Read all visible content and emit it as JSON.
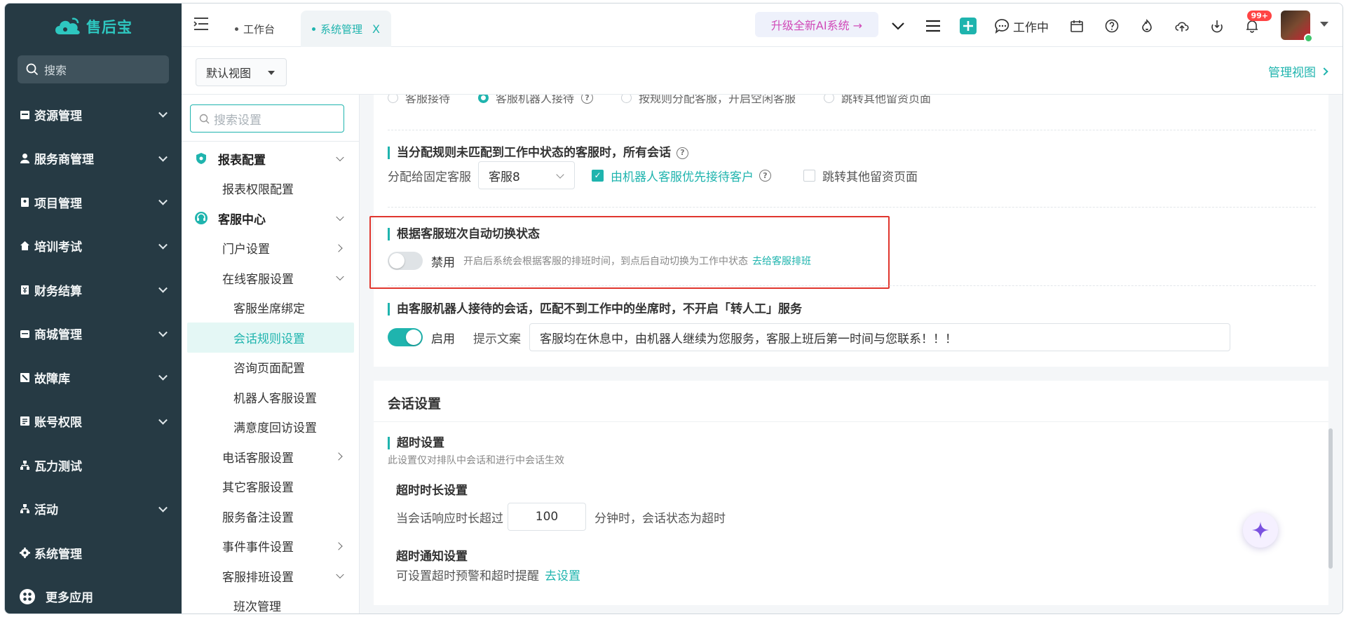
{
  "app": {
    "logo_text": "售后宝"
  },
  "sidebar": {
    "search_placeholder": "搜索",
    "items": [
      {
        "label": "资源管理",
        "icon": "resource-icon"
      },
      {
        "label": "服务商管理",
        "icon": "user-icon"
      },
      {
        "label": "项目管理",
        "icon": "project-icon"
      },
      {
        "label": "培训考试",
        "icon": "home-icon"
      },
      {
        "label": "财务结算",
        "icon": "finance-icon"
      },
      {
        "label": "商城管理",
        "icon": "store-icon"
      },
      {
        "label": "故障库",
        "icon": "fault-icon"
      },
      {
        "label": "账号权限",
        "icon": "account-icon"
      },
      {
        "label": "瓦力测试",
        "icon": "test-icon"
      },
      {
        "label": "活动",
        "icon": "activity-icon"
      },
      {
        "label": "系统管理",
        "icon": "gear-icon"
      }
    ],
    "more_label": "更多应用"
  },
  "header": {
    "tabs": [
      {
        "label": "工作台"
      },
      {
        "label": "系统管理",
        "close": "X"
      }
    ],
    "ai_upgrade": "升级全新AI系统 →",
    "status_label": "工作中",
    "notification_badge": "99+"
  },
  "viewbar": {
    "view_select": "默认视图",
    "manage_view": "管理视图"
  },
  "settings_nav": {
    "search_placeholder": "搜索设置",
    "items": [
      {
        "label": "报表配置"
      },
      {
        "label": "报表权限配置"
      },
      {
        "label": "客服中心"
      },
      {
        "label": "门户设置"
      },
      {
        "label": "在线客服设置"
      },
      {
        "label": "客服坐席绑定"
      },
      {
        "label": "会话规则设置"
      },
      {
        "label": "咨询页面配置"
      },
      {
        "label": "机器人客服设置"
      },
      {
        "label": "满意度回访设置"
      },
      {
        "label": "电话客服设置"
      },
      {
        "label": "其它客服设置"
      },
      {
        "label": "服务备注设置"
      },
      {
        "label": "事件事件设置"
      },
      {
        "label": "客服排班设置"
      },
      {
        "label": "班次管理"
      }
    ]
  },
  "main": {
    "cut_options": [
      "客服接待",
      "客服机器人接待",
      "按规则分配客服，开启空闲客服",
      "跳转其他留资页面"
    ],
    "unmatched": {
      "title": "当分配规则未匹配到工作中状态的客服时，所有会话",
      "assign_label": "分配给固定客服",
      "assign_value": "客服8",
      "robot_first": "由机器人客服优先接待客户",
      "redirect": "跳转其他留资页面"
    },
    "auto_switch": {
      "title": "根据客服班次自动切换状态",
      "toggle_label": "禁用",
      "hint": "开启后系统会根据客服的排班时间，到点后自动切换为工作中状态",
      "link": "去给客服排班"
    },
    "robot_session": {
      "title": "由客服机器人接待的会话，匹配不到工作中的坐席时，不开启「转人工」服务",
      "toggle_label": "启用",
      "prompt_label": "提示文案",
      "prompt_value": "客服均在休息中，由机器人继续为您服务，客服上班后第一时间与您联系！！！"
    },
    "session": {
      "title": "会话设置",
      "timeout_title": "超时设置",
      "timeout_hint": "此设置仅对排队中会话和进行中会话生效",
      "duration_title": "超时时长设置",
      "duration_prefix": "当会话响应时长超过",
      "duration_value": "100",
      "duration_suffix": "分钟时，会话状态为超时",
      "notify_title": "超时通知设置",
      "notify_text": "可设置超时预警和超时提醒",
      "notify_link": "去设置"
    }
  },
  "colors": {
    "accent": "#1fb4ae",
    "sidebar": "#263a44",
    "highlight": "#e0362e"
  }
}
